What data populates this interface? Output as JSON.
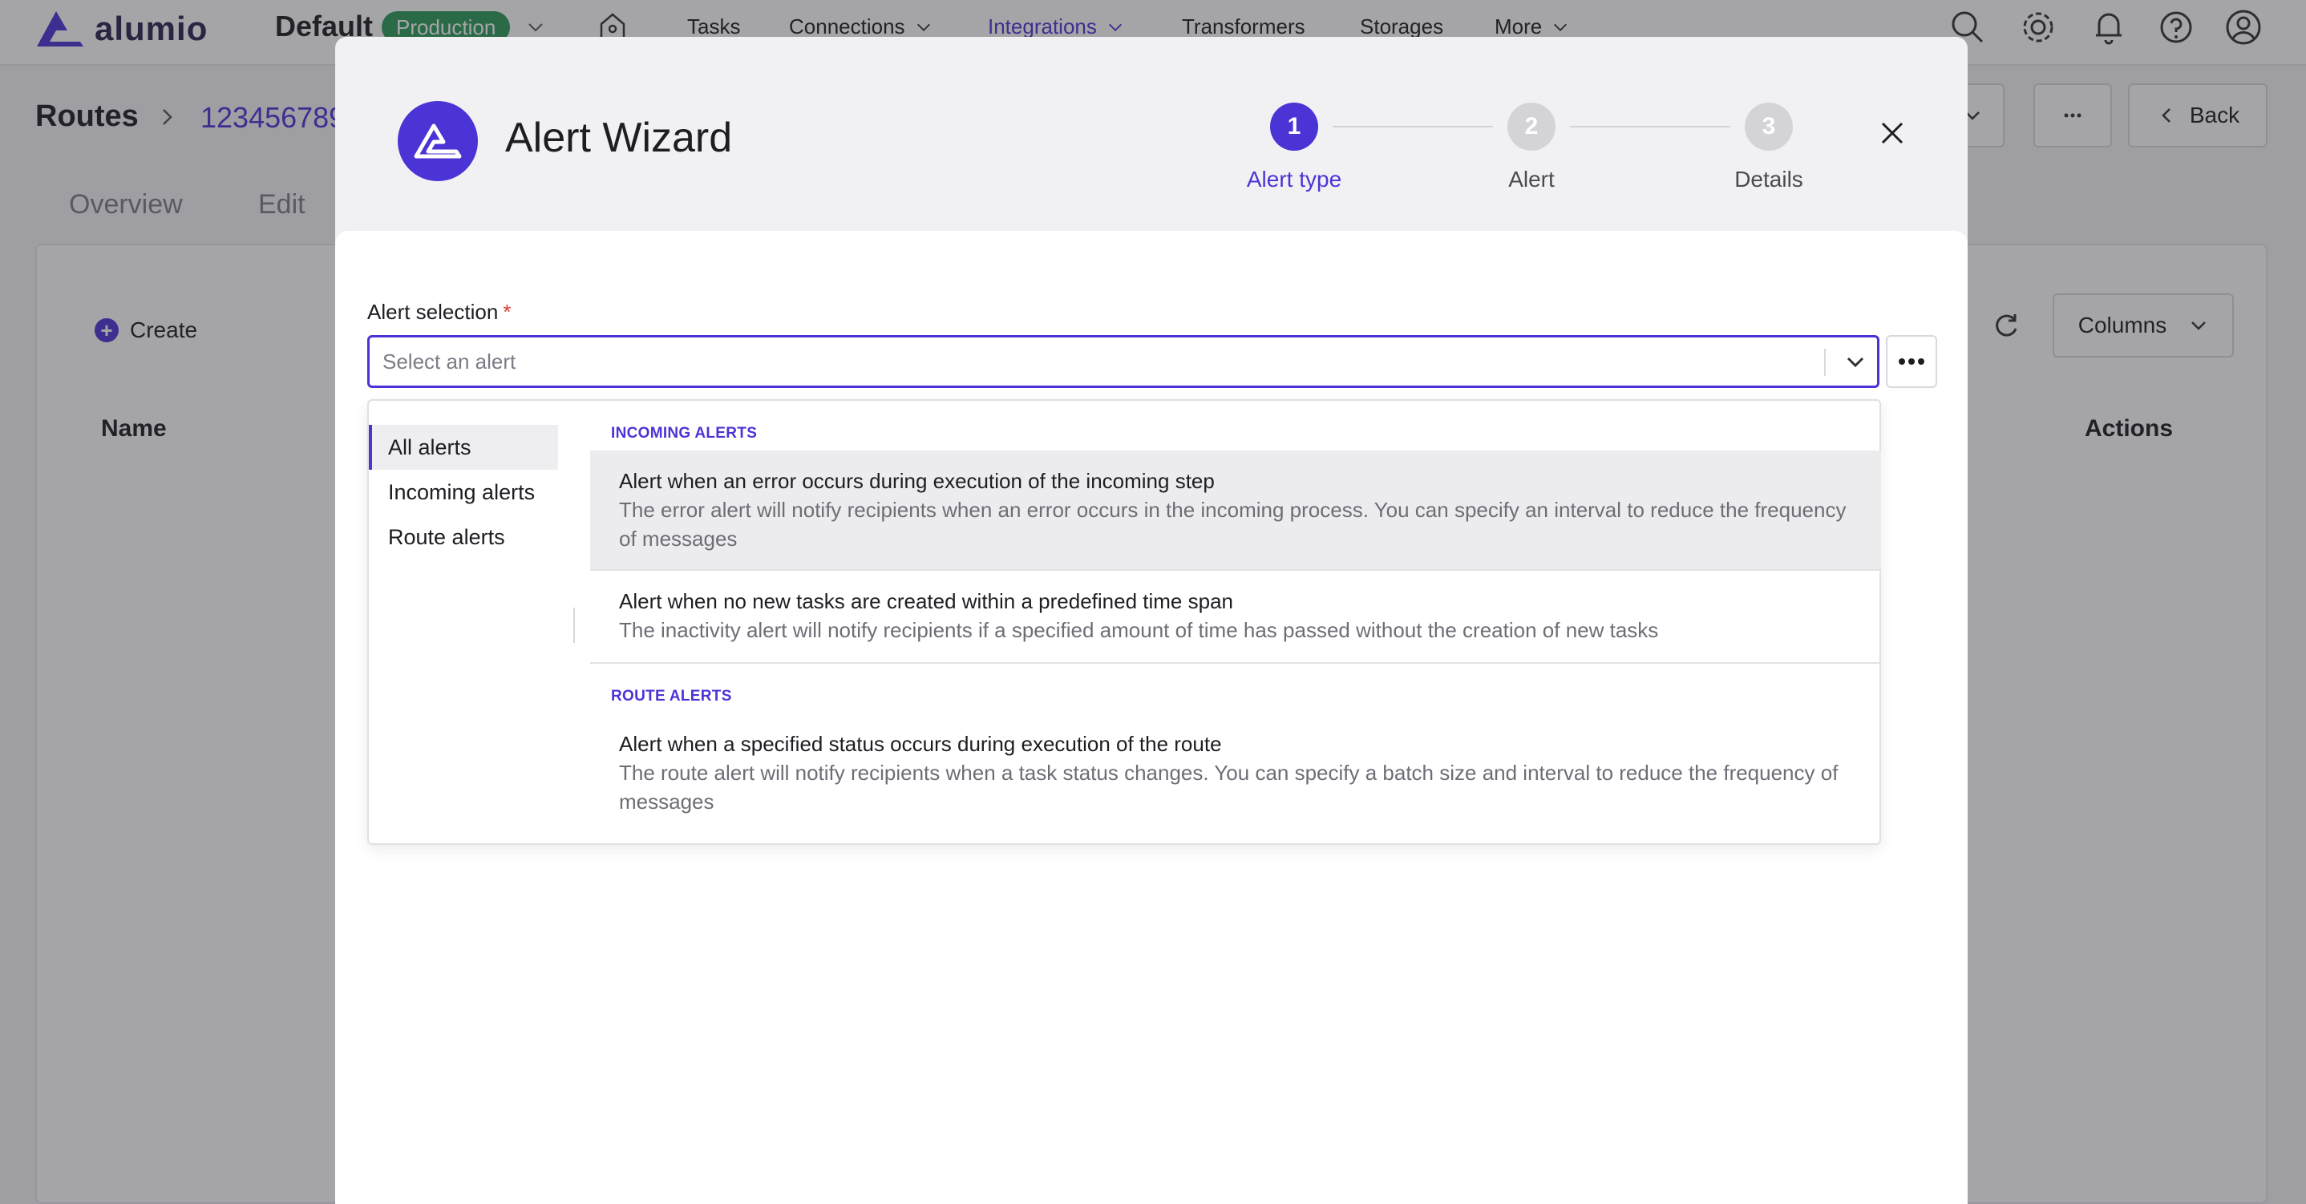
{
  "app": {
    "logo_text": "alumio",
    "environment": "Default",
    "environment_badge": "Production",
    "nav": [
      {
        "label": "Tasks",
        "dropdown": false,
        "active": false
      },
      {
        "label": "Connections",
        "dropdown": true,
        "active": false
      },
      {
        "label": "Integrations",
        "dropdown": true,
        "active": true
      },
      {
        "label": "Transformers",
        "dropdown": false,
        "active": false
      },
      {
        "label": "Storages",
        "dropdown": false,
        "active": false
      },
      {
        "label": "More",
        "dropdown": true,
        "active": false
      }
    ],
    "top_icons": [
      "search-icon",
      "gear-icon",
      "bell-icon",
      "help-icon",
      "user-icon"
    ]
  },
  "page": {
    "breadcrumb_title": "Routes",
    "breadcrumb_id": "123456789",
    "tabs": [
      "Overview",
      "Edit"
    ],
    "back_label": "Back",
    "create_label": "Create",
    "columns_label": "Columns",
    "table_headers": {
      "name": "Name",
      "actions": "Actions"
    }
  },
  "modal": {
    "title": "Alert Wizard",
    "steps": [
      {
        "number": "1",
        "label": "Alert type",
        "state": "active"
      },
      {
        "number": "2",
        "label": "Alert",
        "state": "inactive"
      },
      {
        "number": "3",
        "label": "Details",
        "state": "inactive"
      }
    ],
    "field_label": "Alert selection",
    "required_marker": "*",
    "select_placeholder": "Select an alert",
    "categories": [
      "All alerts",
      "Incoming alerts",
      "Route alerts"
    ],
    "selected_category": "All alerts",
    "groups": [
      {
        "title": "INCOMING ALERTS",
        "options": [
          {
            "title": "Alert when an error occurs during execution of the incoming step",
            "description": "The error alert will notify recipients when an error occurs in the incoming process. You can specify an interval to reduce the frequency of messages"
          },
          {
            "title": "Alert when no new tasks are created within a predefined time span",
            "description": "The inactivity alert will notify recipients if a specified amount of time has passed without the creation of new tasks"
          }
        ]
      },
      {
        "title": "ROUTE ALERTS",
        "options": [
          {
            "title": "Alert when a specified status occurs during execution of the route",
            "description": "The route alert will notify recipients when a task status changes. You can specify a batch size and interval to reduce the frequency of messages"
          }
        ]
      }
    ]
  },
  "colors": {
    "accent": "#4b34d6",
    "production_badge": "#2c9a58",
    "required": "#d93a2e"
  }
}
